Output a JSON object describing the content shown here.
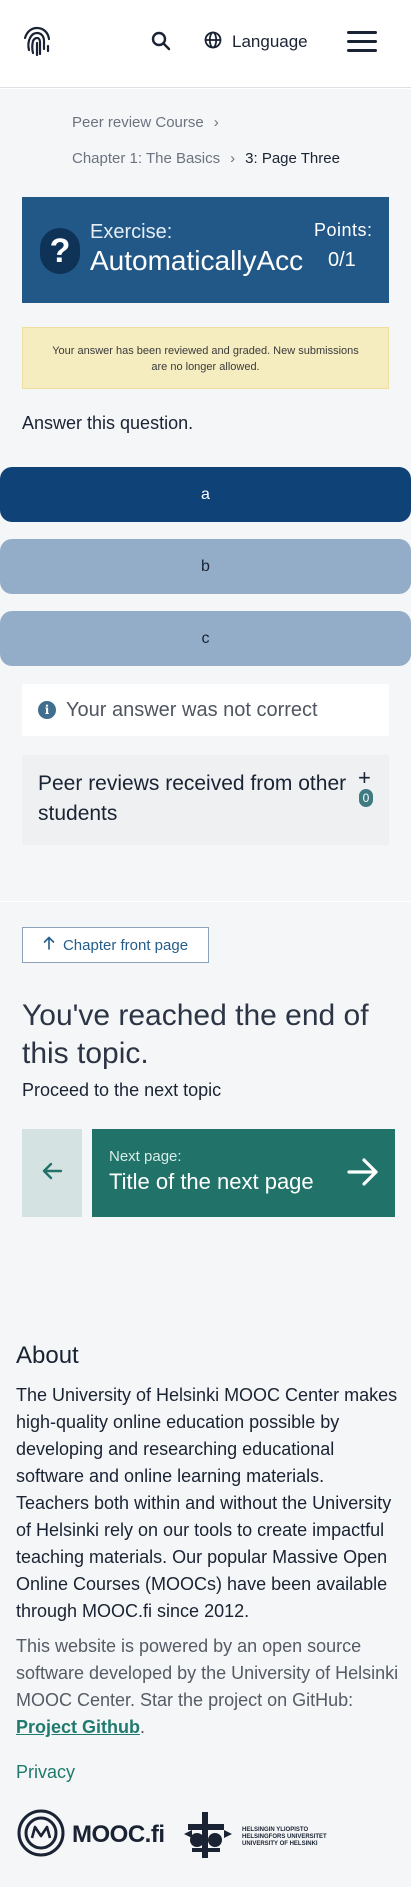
{
  "header": {
    "language_label": "Language"
  },
  "breadcrumb": {
    "course": "Peer review Course",
    "chapter": "Chapter 1: The Basics",
    "page": "3: Page Three"
  },
  "exercise": {
    "label": "Exercise:",
    "title": "AutomaticallyAcc",
    "points_label": "Points:",
    "points_value": "0/1",
    "notice": "Your answer has been reviewed and graded. New submissions are no longer allowed.",
    "question": "Answer this question.",
    "options": [
      "a",
      "b",
      "c"
    ],
    "selected_option": "a",
    "result_text": "Your answer was not correct",
    "peer_reviews_label": "Peer reviews received from other students",
    "peer_reviews_count": "0"
  },
  "end_of_topic": {
    "front_page_label": "Chapter front page",
    "title": "You've reached the end of this topic.",
    "proceed": "Proceed to the next topic",
    "next_label": "Next page:",
    "next_title": "Title of the next page"
  },
  "footer": {
    "about_title": "About",
    "about_text": "The University of Helsinki MOOC Center makes high-quality online education possible by developing and researching educational software and online learning materials. Teachers both within and without the University of Helsinki rely on our tools to create impactful teaching materials. Our popular Massive Open Online Courses (MOOCs) have been available through MOOC.fi since 2012.",
    "powered_text": "This website is powered by an open source software developed by the University of Helsinki MOOC Center. Star the project on GitHub: ",
    "github_link": "Project Github",
    "period": ".",
    "privacy": "Privacy",
    "mooc_logo_text": "MOOC.fi",
    "uh_line1": "HELSINGIN YLIOPISTO",
    "uh_line2": "HELSINGFORS UNIVERSITET",
    "uh_line3": "UNIVERSITY OF HELSINKI"
  },
  "colors": {
    "exercise_header": "#215887",
    "selected_option": "#0f4377",
    "option": "#93adc8",
    "next_button": "#217369",
    "link": "#207a6e"
  }
}
